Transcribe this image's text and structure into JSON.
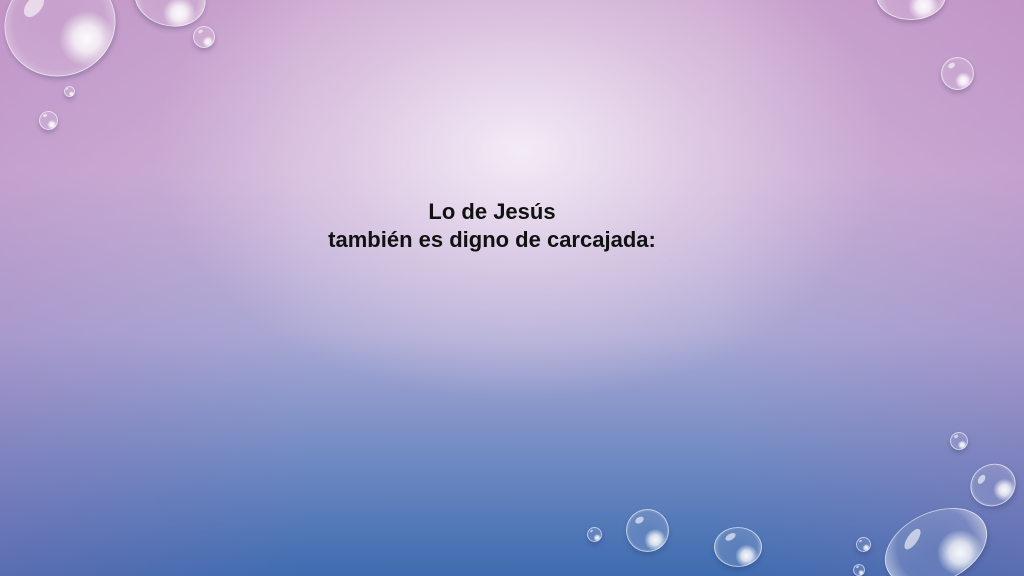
{
  "slide": {
    "title_line1": "Lo de Jesús",
    "title_line2": "también es digno de carcajada:"
  },
  "colors": {
    "background_top": "#c9a3cd",
    "background_center": "#f3ecf5",
    "background_bottom": "#3e6cb0",
    "text": "#111111"
  }
}
